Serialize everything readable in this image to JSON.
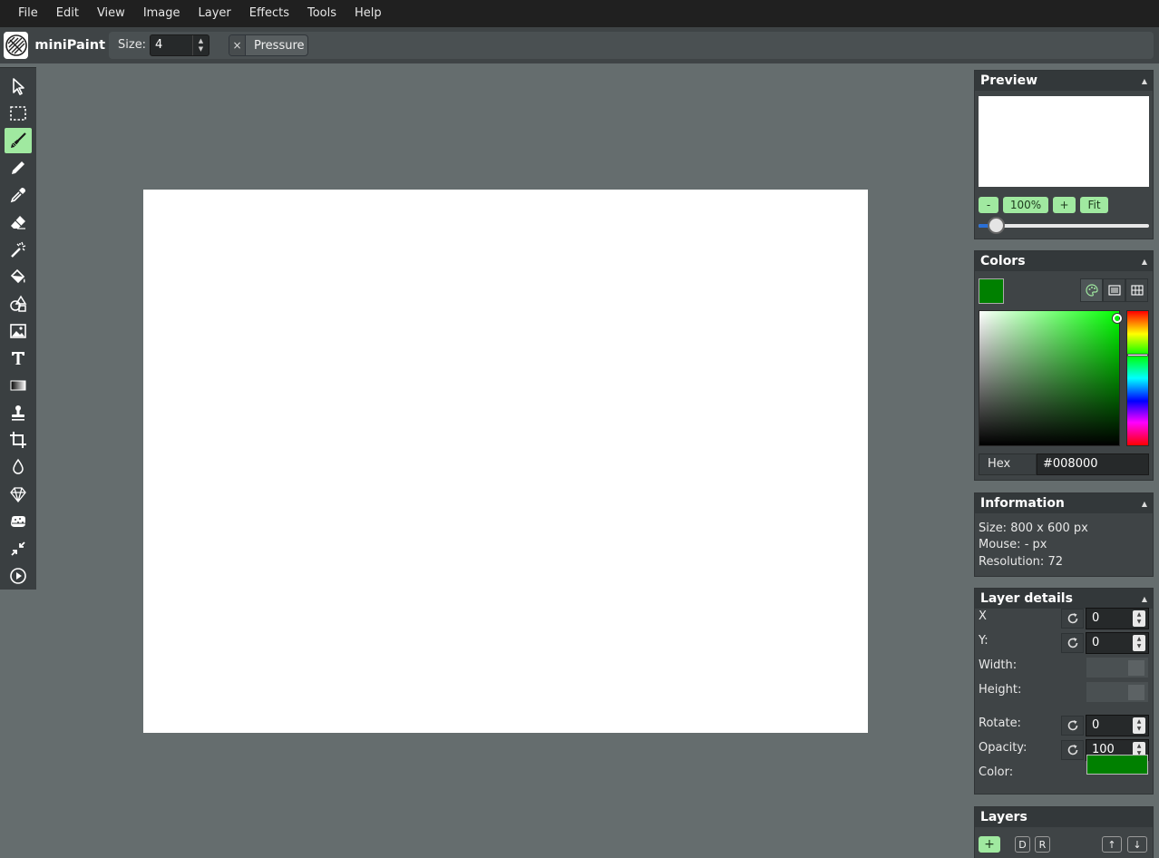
{
  "menu": [
    "File",
    "Edit",
    "View",
    "Image",
    "Layer",
    "Effects",
    "Tools",
    "Help"
  ],
  "app": {
    "name": "miniPaint"
  },
  "attributes": {
    "size_label": "Size:",
    "size_value": "4",
    "pressure_label": "Pressure",
    "pressure_toggle": "×"
  },
  "tools": [
    {
      "name": "select",
      "icon": "arrow-pointer-icon"
    },
    {
      "name": "selection",
      "icon": "dashed-rectangle-icon"
    },
    {
      "name": "brush",
      "icon": "brush-icon",
      "active": true
    },
    {
      "name": "pencil",
      "icon": "pencil-icon"
    },
    {
      "name": "pick-color",
      "icon": "eyedropper-icon"
    },
    {
      "name": "erase",
      "icon": "eraser-icon"
    },
    {
      "name": "magic-wand",
      "icon": "magic-wand-icon"
    },
    {
      "name": "fill",
      "icon": "paint-bucket-icon"
    },
    {
      "name": "shape",
      "icon": "shapes-icon"
    },
    {
      "name": "media",
      "icon": "image-icon"
    },
    {
      "name": "text",
      "icon": "text-icon"
    },
    {
      "name": "gradient",
      "icon": "gradient-icon"
    },
    {
      "name": "clone",
      "icon": "stamp-icon"
    },
    {
      "name": "crop",
      "icon": "crop-icon"
    },
    {
      "name": "blur",
      "icon": "droplet-icon"
    },
    {
      "name": "sharpen",
      "icon": "diamond-icon"
    },
    {
      "name": "bulge-pinch",
      "icon": "sponge-icon"
    },
    {
      "name": "desaturate",
      "icon": "shrink-arrows-icon"
    },
    {
      "name": "animation",
      "icon": "play-circle-icon"
    }
  ],
  "preview": {
    "title": "Preview",
    "zoom_out": "-",
    "zoom_level": "100%",
    "zoom_in": "+",
    "fit": "Fit",
    "zoom_slider_value": 100
  },
  "colors": {
    "title": "Colors",
    "current": "#008000",
    "hex_label": "Hex",
    "hex_value": "#008000"
  },
  "information": {
    "title": "Information",
    "size": "Size: 800 x 600 px",
    "mouse": "Mouse: - px",
    "resolution": "Resolution: 72"
  },
  "layer_details": {
    "title": "Layer details",
    "x_label": "X",
    "x_value": "0",
    "y_label": "Y:",
    "y_value": "0",
    "width_label": "Width:",
    "height_label": "Height:",
    "rotate_label": "Rotate:",
    "rotate_value": "0",
    "opacity_label": "Opacity:",
    "opacity_value": "100",
    "color_label": "Color:",
    "color_value": "#008000"
  },
  "layers": {
    "title": "Layers",
    "add": "+",
    "duplicate": "D",
    "raster": "R",
    "move_up": "↑",
    "move_down": "↓"
  }
}
